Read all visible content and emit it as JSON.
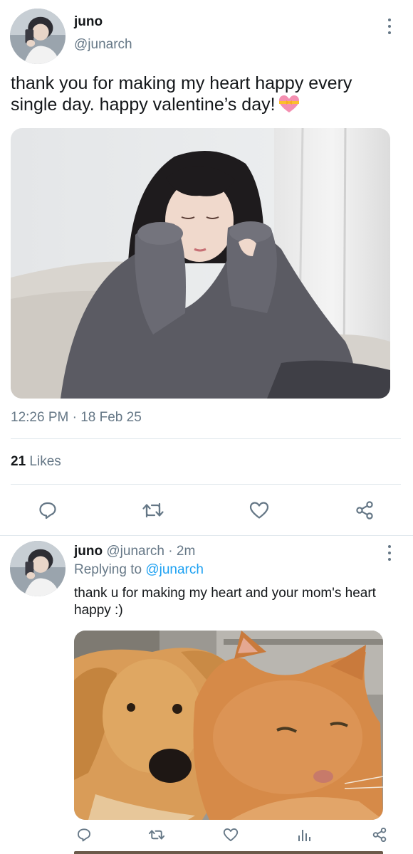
{
  "main_tweet": {
    "author_name": "juno",
    "handle": "@junarch",
    "text": "thank you for making my heart happy every single day. happy valentine’s day!",
    "emoji": "heart-with-ribbon-emoji",
    "timestamp": "12:26 PM · 18 Feb 25",
    "likes_count": "21",
    "likes_label": "Likes",
    "actions": [
      "reply-icon",
      "retweet-icon",
      "like-icon",
      "share-icon"
    ]
  },
  "reply_tweet": {
    "author_name": "juno",
    "handle": "@junarch",
    "time": "· 2m",
    "replying_to_label": "Replying to",
    "replying_to_handle": "@junarch",
    "text": "thank u for making my heart and your mom's heart happy :)",
    "actions": [
      "reply-icon",
      "retweet-icon",
      "like-icon",
      "analytics-icon",
      "share-icon"
    ]
  },
  "colors": {
    "text_primary": "#14171a",
    "text_secondary": "#657786",
    "link": "#1da1f2",
    "divider": "#e1e8ed"
  }
}
